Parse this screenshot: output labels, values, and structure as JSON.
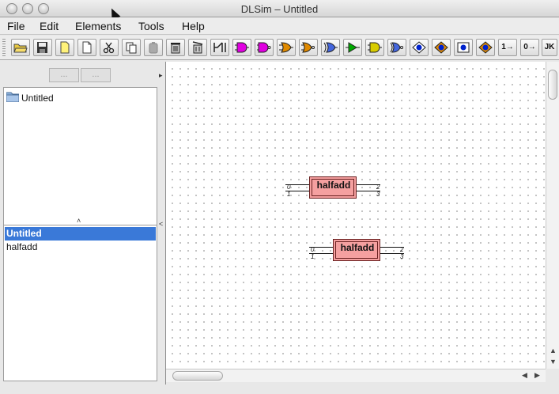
{
  "window": {
    "title": "DLSim – Untitled"
  },
  "menu": {
    "items": [
      "File",
      "Edit",
      "Elements",
      "Tools",
      "Help"
    ]
  },
  "toolbar": {
    "text_buttons": {
      "const_one": "1→",
      "const_zero": "0→",
      "jk_flipflop": "JK"
    },
    "colors": {
      "and": "#e000e0",
      "nand": "#e000e0",
      "or": "#e08a00",
      "nor": "#e08a00",
      "xor": "#2244cc",
      "buffer": "#d8cc00",
      "green": "#00aa00",
      "led_blue": "#0022cc"
    }
  },
  "navigator": {
    "back_label": "...",
    "forward_label": "..."
  },
  "tree": {
    "root_label": "Untitled"
  },
  "list": {
    "items": [
      "Untitled",
      "halfadd"
    ],
    "selected_index": 0
  },
  "canvas": {
    "components": [
      {
        "name": "halfadd",
        "inputs": [
          "0",
          "1"
        ],
        "outputs": [
          "2",
          "3"
        ]
      },
      {
        "name": "halfadd",
        "inputs": [
          "0",
          "1"
        ],
        "outputs": [
          "2",
          "3"
        ]
      }
    ]
  },
  "colors": {
    "component_fill": "#f5a0a0",
    "selection": "#3a79d8"
  }
}
